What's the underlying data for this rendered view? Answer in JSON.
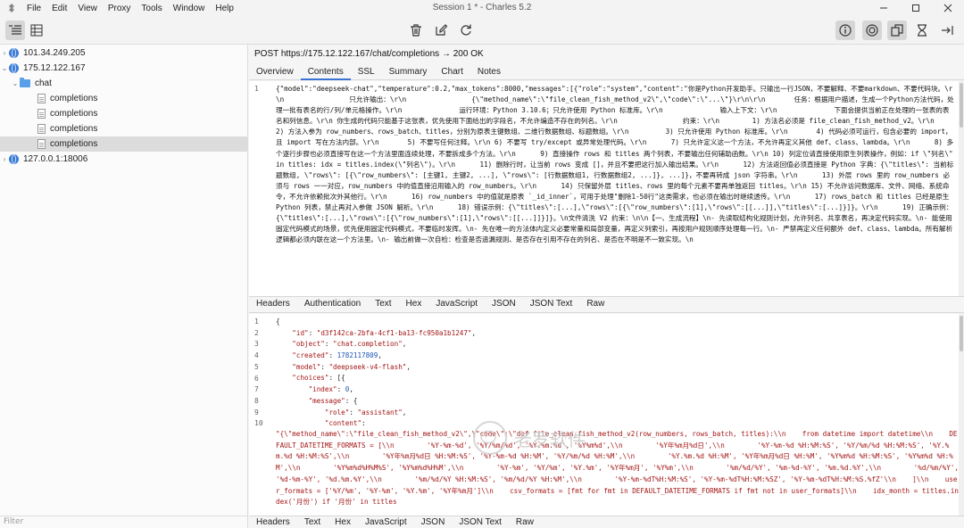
{
  "window": {
    "title": "Session 1 * - Charles 5.2",
    "menus": [
      "File",
      "Edit",
      "View",
      "Proxy",
      "Tools",
      "Window",
      "Help"
    ]
  },
  "toolbar": {
    "left_icons": [
      "structure-view-icon",
      "sequence-view-icon"
    ],
    "center_icons": [
      "trash-icon",
      "edit-icon",
      "refresh-icon"
    ],
    "right_icons": [
      "info-icon",
      "record-icon",
      "throttle-icon",
      "breakpoint-icon",
      "export-icon"
    ]
  },
  "sidebar": {
    "hosts": [
      {
        "label": "101.34.249.205"
      },
      {
        "label": "175.12.122.167"
      },
      {
        "label": "chat"
      },
      {
        "label": "completions"
      },
      {
        "label": "completions"
      },
      {
        "label": "completions"
      },
      {
        "label": "completions"
      },
      {
        "label": "127.0.0.1:18006"
      }
    ],
    "filter_placeholder": "Filter"
  },
  "request": {
    "line": "POST https://175.12.122.167/chat/completions → 200 OK"
  },
  "top_tabs": [
    "Overview",
    "Contents",
    "SSL",
    "Summary",
    "Chart",
    "Notes"
  ],
  "request_body": {
    "line_number": "1",
    "text": "{\"model\":\"deepseek-chat\",\"temperature\":0.2,\"max_tokens\":8000,\"messages\":[{\"role\":\"system\",\"content\":\"你是Python开发助手。只输出一行JSON，不要解释、不要markdown、不要代码块。\\r\\n                只允许输出：\\r\\n                {\\\"method_name\\\":\\\"file_clean_fish_method_v2\\\",\\\"code\\\":\\\"...\\\"}\\r\\n\\r\\n       任务：根据用户描述，生成一个Python方法代码，处理一批有表名的行/列/单元格操作。\\r\\n              运行环境：Python 3.10.6；只允许使用 Python 标准库。\\r\\n              输入上下文：\\r\\n              下面会提供当前正在处理的一张表的表名和列信息。\\r\\n 你生成的代码只能基于这张表，优先使用下面给出的字段名，不允许编造不存在的列名。\\r\\n                约束：\\r\\n        1) 方法名必须是 file_clean_fish_method_v2。\\r\\n              2) 方法入参为 row_numbers、rows_batch、titles，分别为原表主键数组、二维行数据数组、标题数组。\\r\\n         3) 只允许使用 Python 标准库。\\r\\n       4) 代码必须可运行，包含必要的 import，且 import 写在方法内部。\\r\\n       5) 不要写任何注释。\\r\\n 6) 不要写 try/except 或异常处理代码。\\r\\n      7) 只允许定义这一个方法，不允许再定义其他 def、class、lambda。\\r\\n      8) 多个逐行步骤也必须直接写在这一个方法里面连续处理，不要拆成多个方法。\\r\\n      9) 直接操作 rows 和 titles 两个列表，不要输出任何辅助函数。\\r\\n 10) 列定位请直接使用原生列表操作，例如：if \\\"列名\\\" in titles: idx = titles.index(\\\"列名\\\")。\\r\\n      11) 删除行时，让当前 rows 变成 []，并且不要把这行加入输出结果。\\r\\n      12) 方法返回值必须直接是 Python 字典：{\\\"titles\\\": 当前标题数组, \\\"rows\\\": [{\\\"row_numbers\\\": [主键1, 主键2, ...], \\\"rows\\\": [行数据数组1, 行数据数组2, ...]}, ...]}，不要再转成 json 字符串。\\r\\n      13) 外层 rows 里的 row_numbers 必须与 rows 一一对应，row_numbers 中的值直接沿用输入的 row_numbers。\\r\\n      14) 只保留外层 titles、rows 里的每个元素不要再单独返回 titles。\\r\\n 15) 不允许访问数据库、文件、网络、系统命令，不允许依赖批次外其他行。\\r\\n      16) row_numbers 中的值就是原表 `_id_inner`，可用于处理\"删除1-50行\"这类需求，也必须在输出时继续透传。\\r\\n      17) rows_batch 和 titles 已经是原生 Python 列表，禁止再对入参做 JSON 解析。\\r\\n      18) 错误示例：{\\\"titles\\\":[...],\\\"rows\\\":[{\\\"row_numbers\\\":[1],\\\"rows\\\":[[...]],\\\"titles\\\":[...]}]}。\\r\\n      19) 正确示例：{\\\"titles\\\":[...],\\\"rows\\\":[{\\\"row_numbers\\\":[1],\\\"rows\\\":[[...]]}]}。\\n文件清洗 V2 约束：\\n\\n【一、生成流程】\\n- 先读取结构化规则计划，允许列名、共享表名，再决定代码实现。\\n- 能使用固定代码模式的场景，优先使用固定代码模式，不要临时发挥。\\n- 先在唯一的方法体内定义必要常量和局部变量，再定义列索引，再按用户规则顺序处理每一行。\\n- 严禁再定义任何额外 def、class、lambda。所有解析逻辑都必须内联在这一个方法里。\\n- 输出前做一次自检：检查是否遗漏规则、是否存在引用不存在的列名、是否在不明是不一致实现。\\n"
  },
  "mid_tabs": [
    "Headers",
    "Authentication",
    "Text",
    "Hex",
    "JavaScript",
    "JSON",
    "JSON Text",
    "Raw"
  ],
  "response_json": {
    "line_numbers": [
      "1",
      "2",
      "3",
      "4",
      "5",
      "6",
      "7",
      "8",
      "9",
      "10"
    ],
    "id": "d3f142ca-2bfa-4cf1-ba13-fc950a1b1247",
    "object": "chat.completion",
    "created": "1782117809",
    "model": "deepseek-v4-flash",
    "index": "0",
    "role": "assistant",
    "content": "\"{\\\"method_name\\\":\\\"file_clean_fish_method_v2\\\",\\\"code\\\":\\\"def file_clean_fish_method_v2(row_numbers, rows_batch, titles):\\\\n    from datetime import datetime\\\\n    DEFAULT_DATETIME_FORMATS = [\\\\n        '%Y-%m-%d', '%Y/%m/%d', '%Y.%m.%d', '%Y%m%d',\\\\n        '%Y年%m月%d日',\\\\n        '%Y-%m-%d %H:%M:%S', '%Y/%m/%d %H:%M:%S', '%Y.%m.%d %H:%M:%S',\\\\n        '%Y年%m月%d日 %H:%M:%S', '%Y-%m-%d %H:%M', '%Y/%m/%d %H:%M',\\\\n        '%Y.%m.%d %H:%M', '%Y年%m月%d日 %H:%M', '%Y%m%d %H:%M:%S', '%Y%m%d %H:%M',\\\\n        '%Y%m%d%H%M%S', '%Y%m%d%H%M',\\\\n        '%Y-%m', '%Y/%m', '%Y.%m', '%Y年%m月', '%Y%m',\\\\n        '%m/%d/%Y', '%m-%d-%Y', '%m.%d.%Y',\\\\n        '%d/%m/%Y', '%d-%m-%Y', '%d.%m.%Y',\\\\n        '%m/%d/%Y %H:%M:%S', '%m/%d/%Y %H:%M',\\\\n        '%Y-%m-%dT%H:%M:%S', '%Y-%m-%dT%H:%M:%SZ', '%Y-%m-%dT%H:%M:%S.%fZ'\\\\n    ]\\\\n    user_formats = ['%Y/%m', '%Y-%m', '%Y.%m', '%Y年%m月']\\\\n    csv_formats = [fmt for fmt in DEFAULT_DATETIME_FORMATS if fmt not in user_formats]\\\\n    idx_month = titles.index('月份') if '月份' in titles"
  },
  "bottom_tabs": [
    "Headers",
    "Text",
    "Hex",
    "JavaScript",
    "JSON",
    "JSON Text",
    "Raw"
  ],
  "watermark": {
    "text": "老罗软件"
  }
}
